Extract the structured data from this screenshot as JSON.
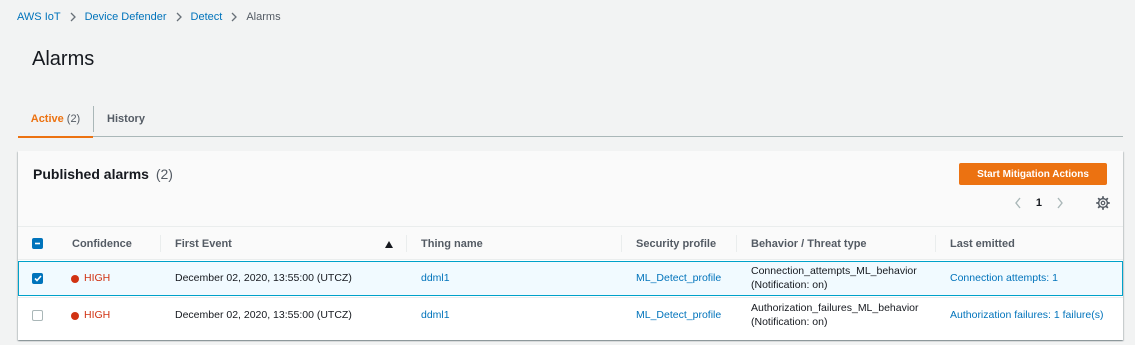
{
  "breadcrumb": [
    "AWS IoT",
    "Device Defender",
    "Detect",
    "Alarms"
  ],
  "page_title": "Alarms",
  "tabs": [
    {
      "label": "Active",
      "count": "(2)"
    },
    {
      "label": "History"
    }
  ],
  "panel": {
    "title": "Published alarms",
    "count": "(2)",
    "primary_action": "Start Mitigation Actions",
    "page": "1"
  },
  "columns": [
    "Confidence",
    "First Event",
    "Thing name",
    "Security profile",
    "Behavior / Threat type",
    "Last emitted"
  ],
  "rows": [
    {
      "selected": true,
      "confidence": "HIGH",
      "first_event": "December 02, 2020, 13:55:00 (UTCZ)",
      "thing_name": "ddml1",
      "security_profile": "ML_Detect_profile",
      "behavior": "Connection_attempts_ML_behavior",
      "notification": "(Notification: on)",
      "last_emitted": "Connection attempts: 1"
    },
    {
      "selected": false,
      "confidence": "HIGH",
      "first_event": "December 02, 2020, 13:55:00 (UTCZ)",
      "thing_name": "ddml1",
      "security_profile": "ML_Detect_profile",
      "behavior": "Authorization_failures_ML_behavior",
      "notification": "(Notification: on)",
      "last_emitted": "Authorization failures: 1 failure(s)"
    }
  ],
  "colors": {
    "accent": "#ec7211",
    "link": "#0073bb",
    "high": "#d13212",
    "selected_row": "#f1faff"
  }
}
